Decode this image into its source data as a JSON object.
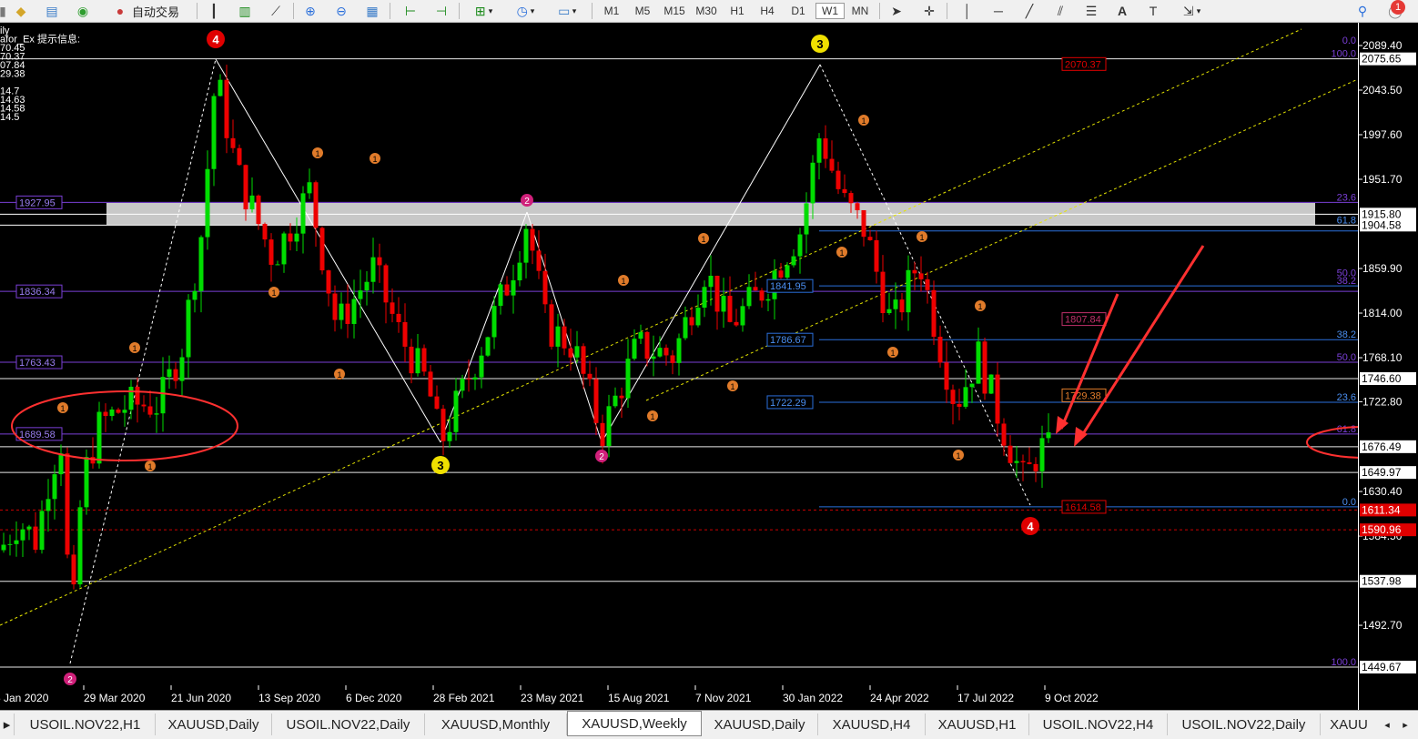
{
  "toolbar": {
    "auto_trade_label": "自动交易",
    "timeframes": [
      "M1",
      "M5",
      "M15",
      "M30",
      "H1",
      "H4",
      "D1",
      "W1",
      "MN"
    ],
    "active_timeframe": "W1",
    "notification_count": "1"
  },
  "chart": {
    "info_lines": [
      "ily",
      "afor_Ex 提示信息:",
      "70.45",
      "70.37",
      "07.84",
      "29.38",
      "",
      "14.7",
      "14.63",
      "14.58",
      "14.5"
    ],
    "price_axis_labels": [
      "2089.40",
      "2043.50",
      "1997.60",
      "1951.70",
      "1859.90",
      "1814.00",
      "1768.10",
      "1722.80",
      "1630.40",
      "1584.50",
      "1492.70"
    ],
    "price_boxes": [
      {
        "text": "2075.65",
        "bg": "#ffffff",
        "fg": "#000000"
      },
      {
        "text": "1915.80",
        "bg": "#ffffff",
        "fg": "#000000"
      },
      {
        "text": "1904.58",
        "bg": "#ffffff",
        "fg": "#000000"
      },
      {
        "text": "1746.60",
        "bg": "#ffffff",
        "fg": "#000000"
      },
      {
        "text": "1676.49",
        "bg": "#ffffff",
        "fg": "#000000"
      },
      {
        "text": "1649.97",
        "bg": "#ffffff",
        "fg": "#000000"
      },
      {
        "text": "1611.34",
        "bg": "#e00000",
        "fg": "#ffffff"
      },
      {
        "text": "1590.96",
        "bg": "#e00000",
        "fg": "#ffffff"
      },
      {
        "text": "1537.98",
        "bg": "#ffffff",
        "fg": "#000000"
      },
      {
        "text": "1449.67",
        "bg": "#ffffff",
        "fg": "#000000"
      }
    ],
    "date_labels": [
      "5 Jan 2020",
      "29 Mar 2020",
      "21 Jun 2020",
      "13 Sep 2020",
      "6 Dec 2020",
      "28 Feb 2021",
      "23 May 2021",
      "15 Aug 2021",
      "7 Nov 2021",
      "30 Jan 2022",
      "24 Apr 2022",
      "17 Jul 2022",
      "9 Oct 2022"
    ],
    "level_labels_left": [
      "1927.95",
      "1836.34",
      "1763.43",
      "1689.58"
    ],
    "level_labels_mid": [
      "1841.95",
      "1786.67",
      "1722.29"
    ],
    "level_labels_red": [
      "2070.37",
      "1807.84",
      "1729.38",
      "1614.58"
    ],
    "fib_labels": [
      "100.0",
      "23.6",
      "61.8",
      "50.0",
      "38.2",
      "38.2",
      "50.0",
      "23.6",
      "61.8",
      "0.0",
      "100.0",
      "0.0"
    ],
    "wave_labels": [
      "4",
      "3",
      "2",
      "3",
      "2",
      "4",
      "2",
      "1"
    ]
  },
  "tabs": {
    "items": [
      "USOIL.NOV22,H1",
      "XAUUSD,Daily",
      "USOIL.NOV22,Daily",
      "XAUUSD,Monthly",
      "XAUUSD,Weekly",
      "XAUUSD,Daily",
      "XAUUSD,H4",
      "XAUUSD,H1",
      "USOIL.NOV22,H4",
      "USOIL.NOV22,Daily",
      "XAUU"
    ],
    "active_index": 4
  },
  "colors": {
    "bull_candle": "#00dd00",
    "bear_candle": "#ee0000",
    "blue_line": "#2a6fdb",
    "purple_line": "#7a3fd6",
    "fib_dotted": "#e5e500",
    "annotation_red": "#ff3030"
  }
}
